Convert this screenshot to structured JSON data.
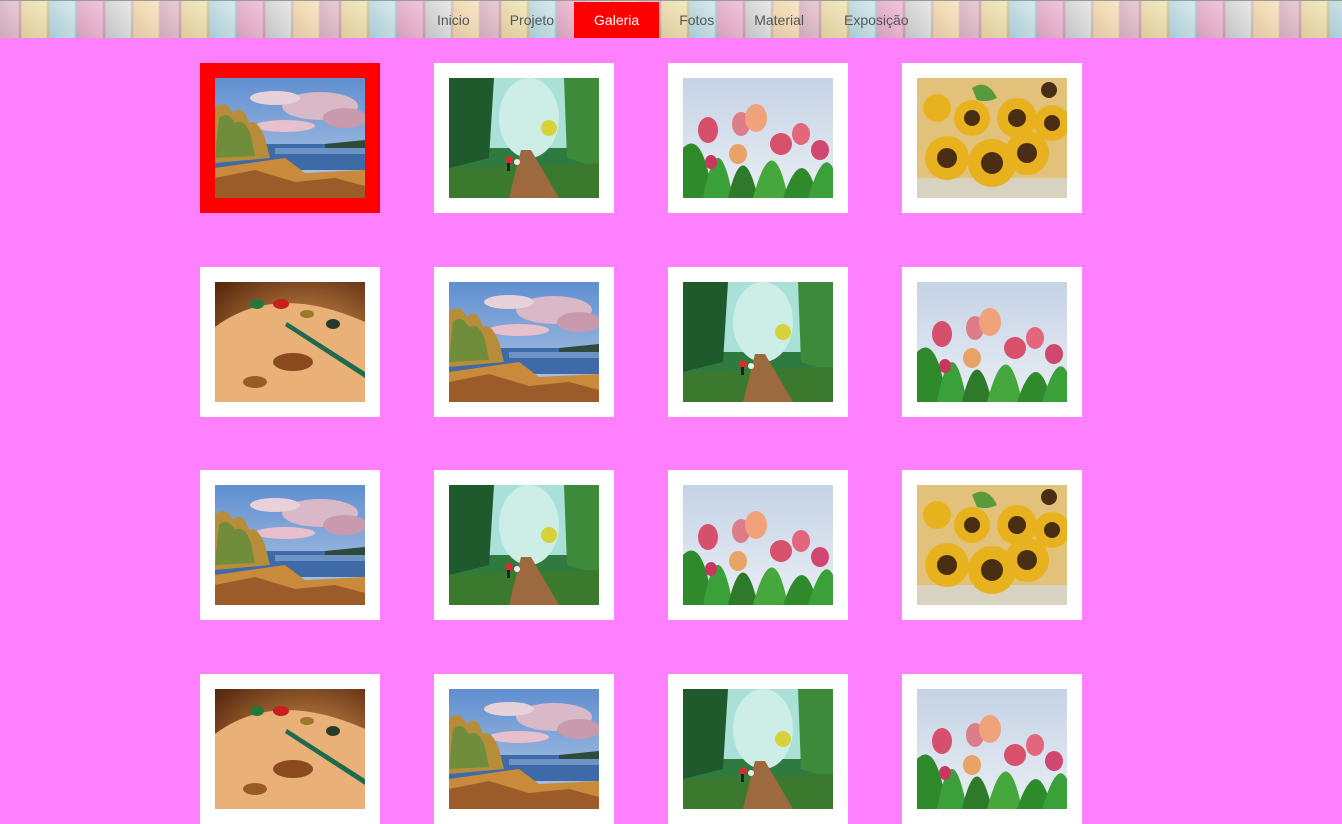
{
  "nav": {
    "items": [
      {
        "label": "Inicio",
        "active": false
      },
      {
        "label": "Projeto",
        "active": false
      },
      {
        "label": "Galeria",
        "active": true
      },
      {
        "label": "Fotos",
        "active": false
      },
      {
        "label": "Material",
        "active": false
      },
      {
        "label": "Exposição",
        "active": false
      }
    ]
  },
  "colors": {
    "page_background": "#ff80ff",
    "accent_active": "#ff0000",
    "thumb_frame": "#ffffff"
  },
  "gallery": {
    "selected_index": 0,
    "thumbnails": [
      {
        "painting": "lake-landscape"
      },
      {
        "painting": "forest-road"
      },
      {
        "painting": "tulips"
      },
      {
        "painting": "sunflowers"
      },
      {
        "painting": "palette"
      },
      {
        "painting": "lake-landscape"
      },
      {
        "painting": "forest-road"
      },
      {
        "painting": "tulips"
      },
      {
        "painting": "lake-landscape"
      },
      {
        "painting": "forest-road"
      },
      {
        "painting": "tulips"
      },
      {
        "painting": "sunflowers"
      },
      {
        "painting": "palette"
      },
      {
        "painting": "lake-landscape"
      },
      {
        "painting": "forest-road"
      },
      {
        "painting": "tulips"
      }
    ]
  }
}
